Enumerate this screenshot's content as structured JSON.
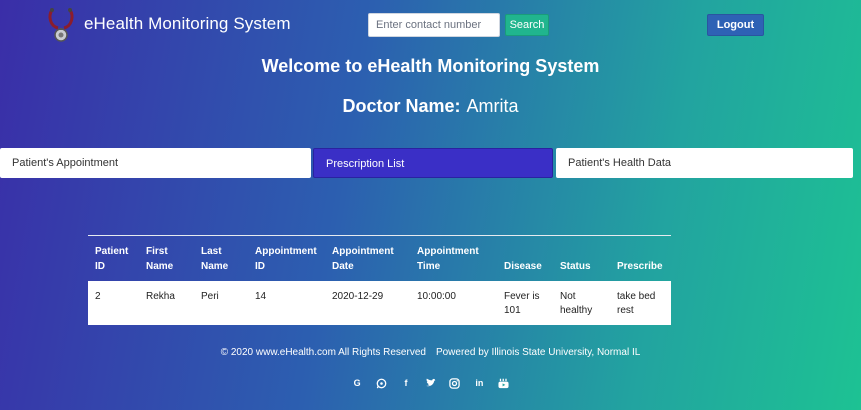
{
  "header": {
    "brand": "eHealth Monitoring System",
    "search_placeholder": "Enter contact number",
    "search_label": "Search",
    "logout_label": "Logout"
  },
  "welcome": "Welcome to eHealth Monitoring System",
  "doctor": {
    "label": "Doctor Name:",
    "name": "Amrita"
  },
  "tabs": [
    {
      "label": "Patient's Appointment",
      "active": false
    },
    {
      "label": "Prescription List",
      "active": true
    },
    {
      "label": "Patient's Health Data",
      "active": false
    }
  ],
  "table": {
    "headers": [
      [
        "Patient",
        "ID"
      ],
      [
        "First",
        "Name"
      ],
      [
        "Last",
        "Name"
      ],
      [
        "Appointment",
        "ID"
      ],
      [
        "Appointment",
        "Date"
      ],
      [
        "Appointment",
        "Time"
      ],
      [
        "Disease"
      ],
      [
        "Status"
      ],
      [
        "Prescribe"
      ]
    ],
    "rows": [
      [
        "2",
        "Rekha",
        "Peri",
        "14",
        "2020-12-29",
        "10:00:00",
        "Fever is 101",
        "Not healthy",
        "take bed rest"
      ]
    ]
  },
  "footer": {
    "copyright": "© 2020 www.eHealth.com All Rights Reserved",
    "powered": "Powered by Illinois State University, Normal IL"
  },
  "social": [
    "google-icon",
    "whatsapp-icon",
    "facebook-icon",
    "twitter-icon",
    "instagram-icon",
    "linkedin-icon",
    "youtube-icon"
  ],
  "colors": {
    "gradient_start": "#3a2ea8",
    "gradient_end": "#1dc293",
    "active_tab": "#3a2fc6",
    "search_button": "#20b58e",
    "logout_button": "#2e62b5"
  }
}
